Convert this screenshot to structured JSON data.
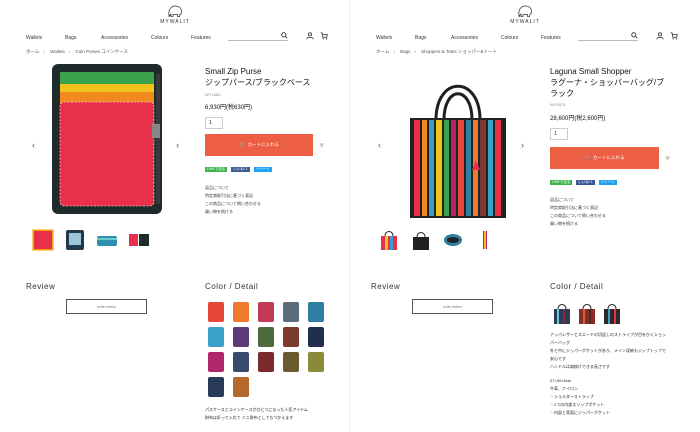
{
  "brand": {
    "name": "MYWALIT",
    "logo_icon": "elephant-icon"
  },
  "nav": {
    "items": [
      "Wallets",
      "Bags",
      "Accessories",
      "Colours",
      "Features"
    ],
    "search_icon": "search-icon",
    "user_icon": "user-icon",
    "cart_icon": "cart-icon"
  },
  "left": {
    "breadcrumb": [
      "ホーム",
      "Wallets",
      "Coin Purses コインケース"
    ],
    "title_en": "Small Zip Purse",
    "title_jp": "ジップパース/ブラックベース",
    "sku": "WY1384",
    "price": "6,930円(税630円)",
    "qty": "1",
    "cart_label": "カートに入れる",
    "share": [
      "LINEで送る",
      "いいね! 1",
      "ツイート"
    ],
    "links": [
      "返品について",
      "特定商取引法に基づく表記",
      "この商品について問い合わせる",
      "買い物を続ける"
    ],
    "review_heading": "Review",
    "write_review": "write review",
    "detail_heading": "Color  /  Detail",
    "description": [
      "パスケースとコインケースがひとつになった人気アイテム",
      "財布は折って入れて ミニ財布としてもつかえます"
    ],
    "swatches": [
      "#e8463b",
      "#f07a30",
      "#c23a55",
      "#5a6b7a",
      "#2e7fa0",
      "#3aa0c8",
      "#5b3a7a",
      "#4e6b3c",
      "#7b3c2e",
      "#222f4a",
      "#b0266a",
      "#3a4a6e",
      "#7a2a2a",
      "#6a5a2e",
      "#8a8a3a",
      "#2a3a5a",
      "#b4692a",
      "#6a3a3a"
    ]
  },
  "right": {
    "breadcrumb": [
      "ホーム",
      "Bags",
      "Shoppers & Totes ショッパー&トート"
    ],
    "title_en": "Laguna Small Shopper",
    "title_jp": "ラグーナ・ショッパーバッグ/ブラック",
    "sku": "WY5073",
    "price": "28,600円(税2,600円)",
    "qty": "1",
    "cart_label": "カートに入れる",
    "share": [
      "LINEで送る",
      "いいね! 1",
      "ツイート"
    ],
    "links": [
      "返品について",
      "特定商取引法に基づく表記",
      "この商品について問い合わせる",
      "買い物を続ける"
    ],
    "review_heading": "Review",
    "write_review": "write review",
    "detail_heading": "Color  /  Detail",
    "description": [
      "ナッパレザーとスエードの切返しのストライプが目をひくショッ",
      "パーバッグ",
      "外と中にジッパーポケットがあり、メイン収納もジップトップで",
      "安心です",
      "ハンドルは肩掛けできる長さです",
      "",
      "27×30×5cm",
      "牛革、ナイロン",
      "・ショルダーストラップ",
      "・2つの内部スリップポケット",
      "・内部と背面にジッパーポケット"
    ],
    "swatches": [
      "#2c3b5a",
      "#8a2a2a",
      "#2a2a2a"
    ]
  },
  "colors": {
    "accent": "#ec5f45",
    "line": "#3bb44a",
    "facebook": "#3b5998",
    "twitter": "#1da1f2"
  }
}
